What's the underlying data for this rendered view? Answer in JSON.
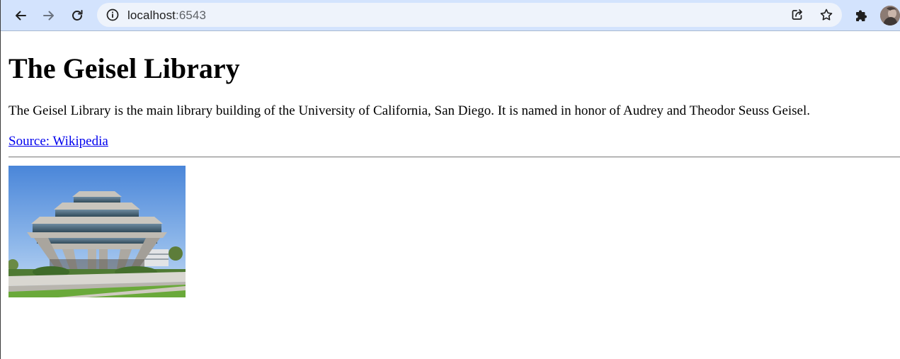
{
  "browser": {
    "url_host": "localhost",
    "url_port": ":6543",
    "icons": {
      "back": "arrow-left-icon",
      "forward": "arrow-right-icon",
      "reload": "reload-icon",
      "site_info": "info-icon",
      "share": "share-icon",
      "bookmark": "star-icon",
      "extensions": "puzzle-icon",
      "profile": "avatar"
    }
  },
  "page": {
    "title": "The Geisel Library",
    "description": "The Geisel Library is the main library building of the University of California, San Diego. It is named in honor of Audrey and Theodor Seuss Geisel.",
    "source_link": "Source: Wikipedia",
    "link_color": "#0000ee"
  },
  "colors": {
    "toolbar_bg": "#d3e3fd",
    "omnibox_bg": "#eef3fb"
  }
}
